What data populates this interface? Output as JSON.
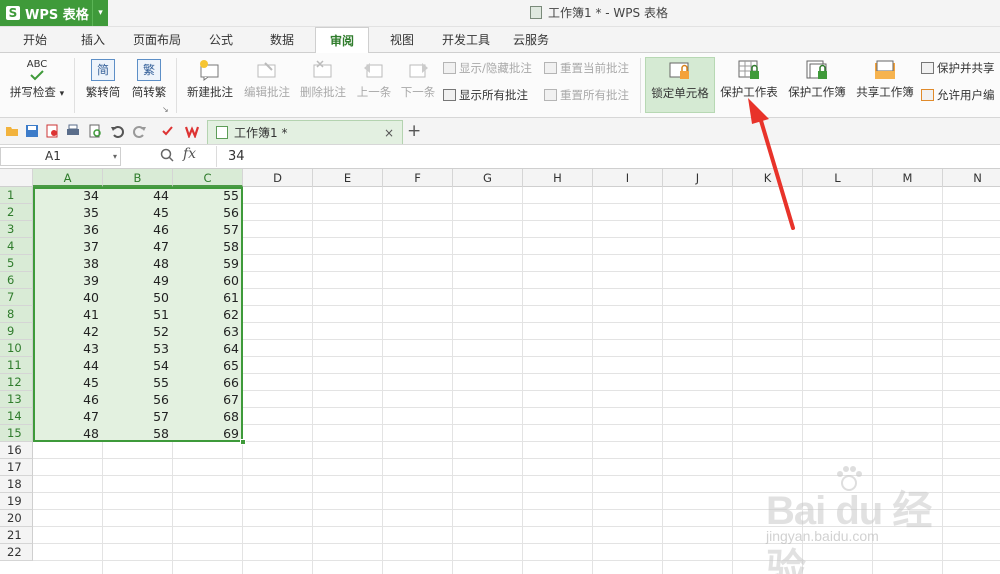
{
  "app": {
    "logo_letter": "S",
    "name": "WPS 表格",
    "menu_arrow": "▾"
  },
  "window": {
    "title": "工作簿1 * - WPS 表格"
  },
  "menu_tabs": [
    "开始",
    "插入",
    "页面布局",
    "公式",
    "数据",
    "审阅",
    "视图",
    "开发工具",
    "云服务"
  ],
  "active_tab": "审阅",
  "ribbon": {
    "spell_check": {
      "label": "拼写检查",
      "icon_text": "ABC",
      "arrow": "▾"
    },
    "trad_to_simp": {
      "label": "繁转简",
      "icon_text": "简"
    },
    "simp_to_trad": {
      "label": "简转繁",
      "icon_text": "繁"
    },
    "group_launcher": "↘",
    "new_comment": {
      "label": "新建批注"
    },
    "edit_comment": {
      "label": "编辑批注"
    },
    "delete_comment": {
      "label": "删除批注"
    },
    "prev": {
      "label": "上一条"
    },
    "next": {
      "label": "下一条"
    },
    "show_hide_comment": {
      "label": "显示/隐藏批注"
    },
    "show_all_comments": {
      "label": "显示所有批注"
    },
    "reset_current_comment": {
      "label": "重置当前批注"
    },
    "reset_all_comments": {
      "label": "重置所有批注"
    },
    "lock_cell": {
      "label": "锁定单元格"
    },
    "protect_sheet": {
      "label": "保护工作表"
    },
    "protect_workbook": {
      "label": "保护工作簿"
    },
    "share_workbook": {
      "label": "共享工作簿"
    },
    "protect_and_share": {
      "label": "保护并共享"
    },
    "allow_user_edit": {
      "label": "允许用户编"
    }
  },
  "quick_access": [
    "open-folder-icon",
    "save-icon",
    "export-pdf-icon",
    "print-icon",
    "print-preview-icon",
    "undo-icon",
    "redo-icon",
    "customize-icon"
  ],
  "doc_tabs": [
    {
      "label": "工作簿1 *",
      "close": "×"
    }
  ],
  "new_tab_label": "+",
  "formula_bar": {
    "name_box": "A1",
    "name_arrow": "▾",
    "zoom_icon": "🔍",
    "fx_label": "fx",
    "value": "34"
  },
  "columns": [
    "A",
    "B",
    "C",
    "D",
    "E",
    "F",
    "G",
    "H",
    "I",
    "J",
    "K",
    "L",
    "M",
    "N"
  ],
  "selected_columns": [
    "A",
    "B",
    "C"
  ],
  "rows": [
    "1",
    "2",
    "3",
    "4",
    "5",
    "6",
    "7",
    "8",
    "9",
    "10",
    "11",
    "12",
    "13",
    "14",
    "15",
    "16",
    "17",
    "18",
    "19",
    "20",
    "21",
    "22"
  ],
  "selected_row_count": 15,
  "cells": [
    [
      "34",
      "44",
      "55"
    ],
    [
      "35",
      "45",
      "56"
    ],
    [
      "36",
      "46",
      "57"
    ],
    [
      "37",
      "47",
      "58"
    ],
    [
      "38",
      "48",
      "59"
    ],
    [
      "39",
      "49",
      "60"
    ],
    [
      "40",
      "50",
      "61"
    ],
    [
      "41",
      "51",
      "62"
    ],
    [
      "42",
      "52",
      "63"
    ],
    [
      "43",
      "53",
      "64"
    ],
    [
      "44",
      "54",
      "65"
    ],
    [
      "45",
      "55",
      "66"
    ],
    [
      "46",
      "56",
      "67"
    ],
    [
      "47",
      "57",
      "68"
    ],
    [
      "48",
      "58",
      "69"
    ]
  ],
  "watermark": {
    "brand": "Bai du 经验",
    "site": "jingyan.baidu.com"
  },
  "colors": {
    "accent": "#3f9a3a",
    "selection_fill": "#e3f1e0",
    "arrow": "#e8332a"
  }
}
